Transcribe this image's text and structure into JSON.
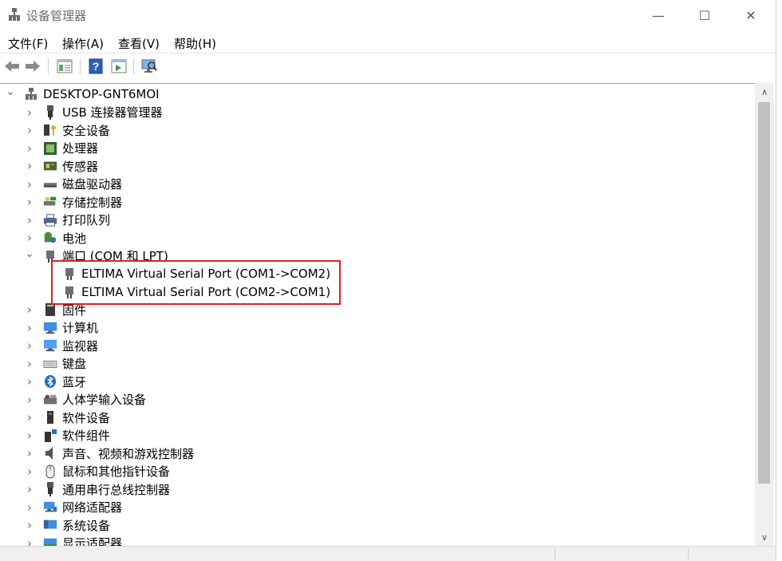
{
  "window": {
    "title": "设备管理器",
    "minimize_glyph": "—",
    "maximize_glyph": "☐",
    "close_glyph": "✕"
  },
  "menu": {
    "file": "文件(F)",
    "action": "操作(A)",
    "view": "查看(V)",
    "help": "帮助(H)"
  },
  "toolbar": {
    "buttons": [
      "back-arrow-icon",
      "forward-arrow-icon",
      "properties-icon",
      "help-icon",
      "update-driver-icon",
      "scan-hardware-icon"
    ]
  },
  "tree": {
    "root": "DESKTOP-GNT6MOI",
    "categories": [
      {
        "label": "USB 连接器管理器",
        "icon": "usb-connector-icon"
      },
      {
        "label": "安全设备",
        "icon": "security-device-icon"
      },
      {
        "label": "处理器",
        "icon": "processor-icon"
      },
      {
        "label": "传感器",
        "icon": "sensor-icon"
      },
      {
        "label": "磁盘驱动器",
        "icon": "disk-drive-icon"
      },
      {
        "label": "存储控制器",
        "icon": "storage-controller-icon"
      },
      {
        "label": "打印队列",
        "icon": "printer-icon"
      },
      {
        "label": "电池",
        "icon": "battery-icon"
      },
      {
        "label": "端口 (COM 和 LPT)",
        "icon": "port-icon",
        "expanded": true,
        "children": [
          "ELTIMA Virtual Serial Port (COM1->COM2)",
          "ELTIMA Virtual Serial Port (COM2->COM1)"
        ]
      },
      {
        "label": "固件",
        "icon": "firmware-icon"
      },
      {
        "label": "计算机",
        "icon": "computer-icon"
      },
      {
        "label": "监视器",
        "icon": "monitor-icon"
      },
      {
        "label": "键盘",
        "icon": "keyboard-icon"
      },
      {
        "label": "蓝牙",
        "icon": "bluetooth-icon"
      },
      {
        "label": "人体学输入设备",
        "icon": "hid-icon"
      },
      {
        "label": "软件设备",
        "icon": "software-device-icon"
      },
      {
        "label": "软件组件",
        "icon": "software-component-icon"
      },
      {
        "label": "声音、视频和游戏控制器",
        "icon": "sound-icon"
      },
      {
        "label": "鼠标和其他指针设备",
        "icon": "mouse-icon"
      },
      {
        "label": "通用串行总线控制器",
        "icon": "usb-controller-icon"
      },
      {
        "label": "网络适配器",
        "icon": "network-adapter-icon"
      },
      {
        "label": "系统设备",
        "icon": "system-device-icon"
      },
      {
        "label": "显示适配器",
        "icon": "display-adapter-icon"
      }
    ]
  },
  "colors": {
    "highlight_border": "#e02020",
    "scrollbar_thumb": "#c1c1c1"
  }
}
